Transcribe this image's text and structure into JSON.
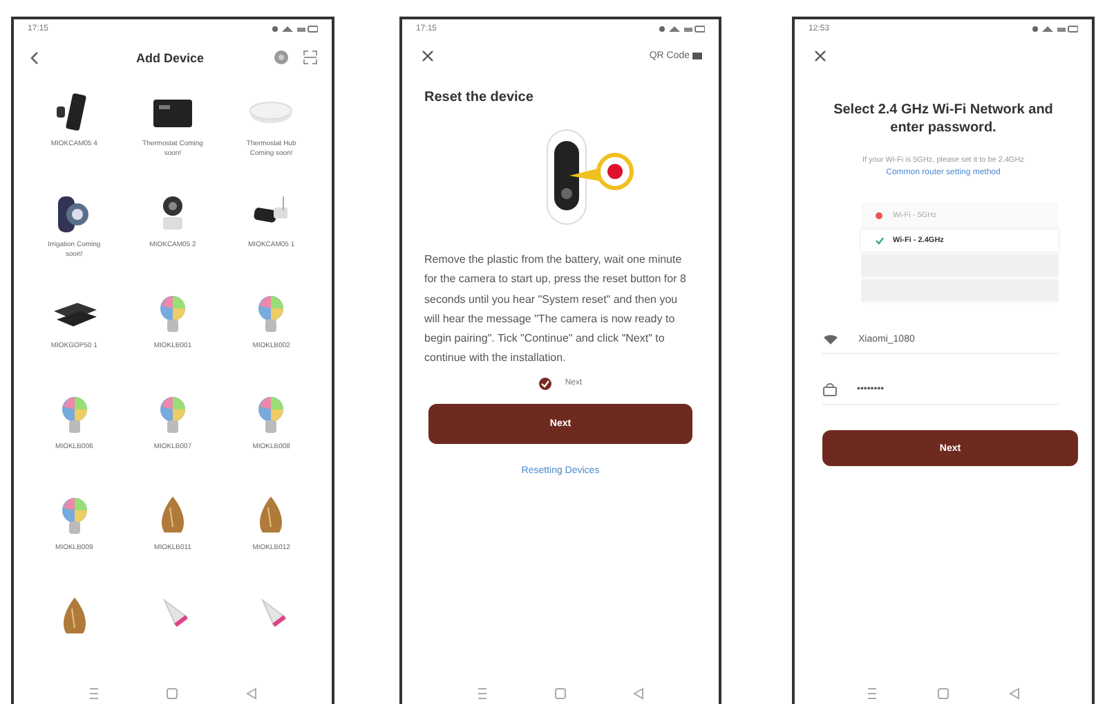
{
  "add_device_screen": {
    "status_bar": {
      "time": "17:15"
    },
    "title": "Add Device",
    "devices": [
      {
        "label": "MIOKCAM05 4",
        "kind": "doorbell"
      },
      {
        "label": "Thermostat Coming soon!",
        "kind": "thermostat"
      },
      {
        "label": "Thermostat Hub Coming soon!",
        "kind": "hub"
      },
      {
        "label": "Irrigation Coming soon!",
        "kind": "valve"
      },
      {
        "label": "MIOKCAM05 2",
        "kind": "indoor_camera"
      },
      {
        "label": "MIOKCAM05 1",
        "kind": "outdoor_camera"
      },
      {
        "label": "MIOKGOP50 1",
        "kind": "router"
      },
      {
        "label": "MIOKLB001",
        "kind": "bulb"
      },
      {
        "label": "MIOKLB002",
        "kind": "bulb"
      },
      {
        "label": "MIOKLB006",
        "kind": "bulb"
      },
      {
        "label": "MIOKLB007",
        "kind": "bulb"
      },
      {
        "label": "MIOKLB008",
        "kind": "bulb"
      },
      {
        "label": "MIOKLB009",
        "kind": "bulb"
      },
      {
        "label": "MIOKLB011",
        "kind": "filament"
      },
      {
        "label": "MIOKLB012",
        "kind": "filament"
      },
      {
        "kind": "filament"
      },
      {
        "kind": "spot"
      },
      {
        "kind": "spot"
      }
    ]
  },
  "reset_screen": {
    "status_bar": {
      "time": "17:15"
    },
    "qr_link": "QR Code",
    "title": "Reset the device",
    "instructions": "Remove the plastic from the battery, wait one minute for the camera to start up, press the reset button for 8 seconds until you hear \"System reset\" and then you will hear the message \"The camera is now ready to begin pairing\". Tick \"Continue\" and click \"Next\" to continue with the installation.",
    "confirm": {
      "label": "Next",
      "checked": true
    },
    "next_button": "Next",
    "help_link": "Resetting Devices"
  },
  "wifi_screen": {
    "status_bar": {
      "time": "12:53"
    },
    "title": "Select 2.4 GHz Wi-Fi Network and enter password.",
    "hint": "If your Wi-Fi is 5GHz, please set it to be 2.4GHz",
    "router_link": "Common router setting method",
    "networks": [
      {
        "name": "Wi-Fi - 5GHz",
        "selected": false
      },
      {
        "name": "Wi-Fi - 2.4GHz",
        "selected": true
      }
    ],
    "ssid": "Xiaomi_1080",
    "password": "••••••••",
    "next_button": "Next"
  }
}
